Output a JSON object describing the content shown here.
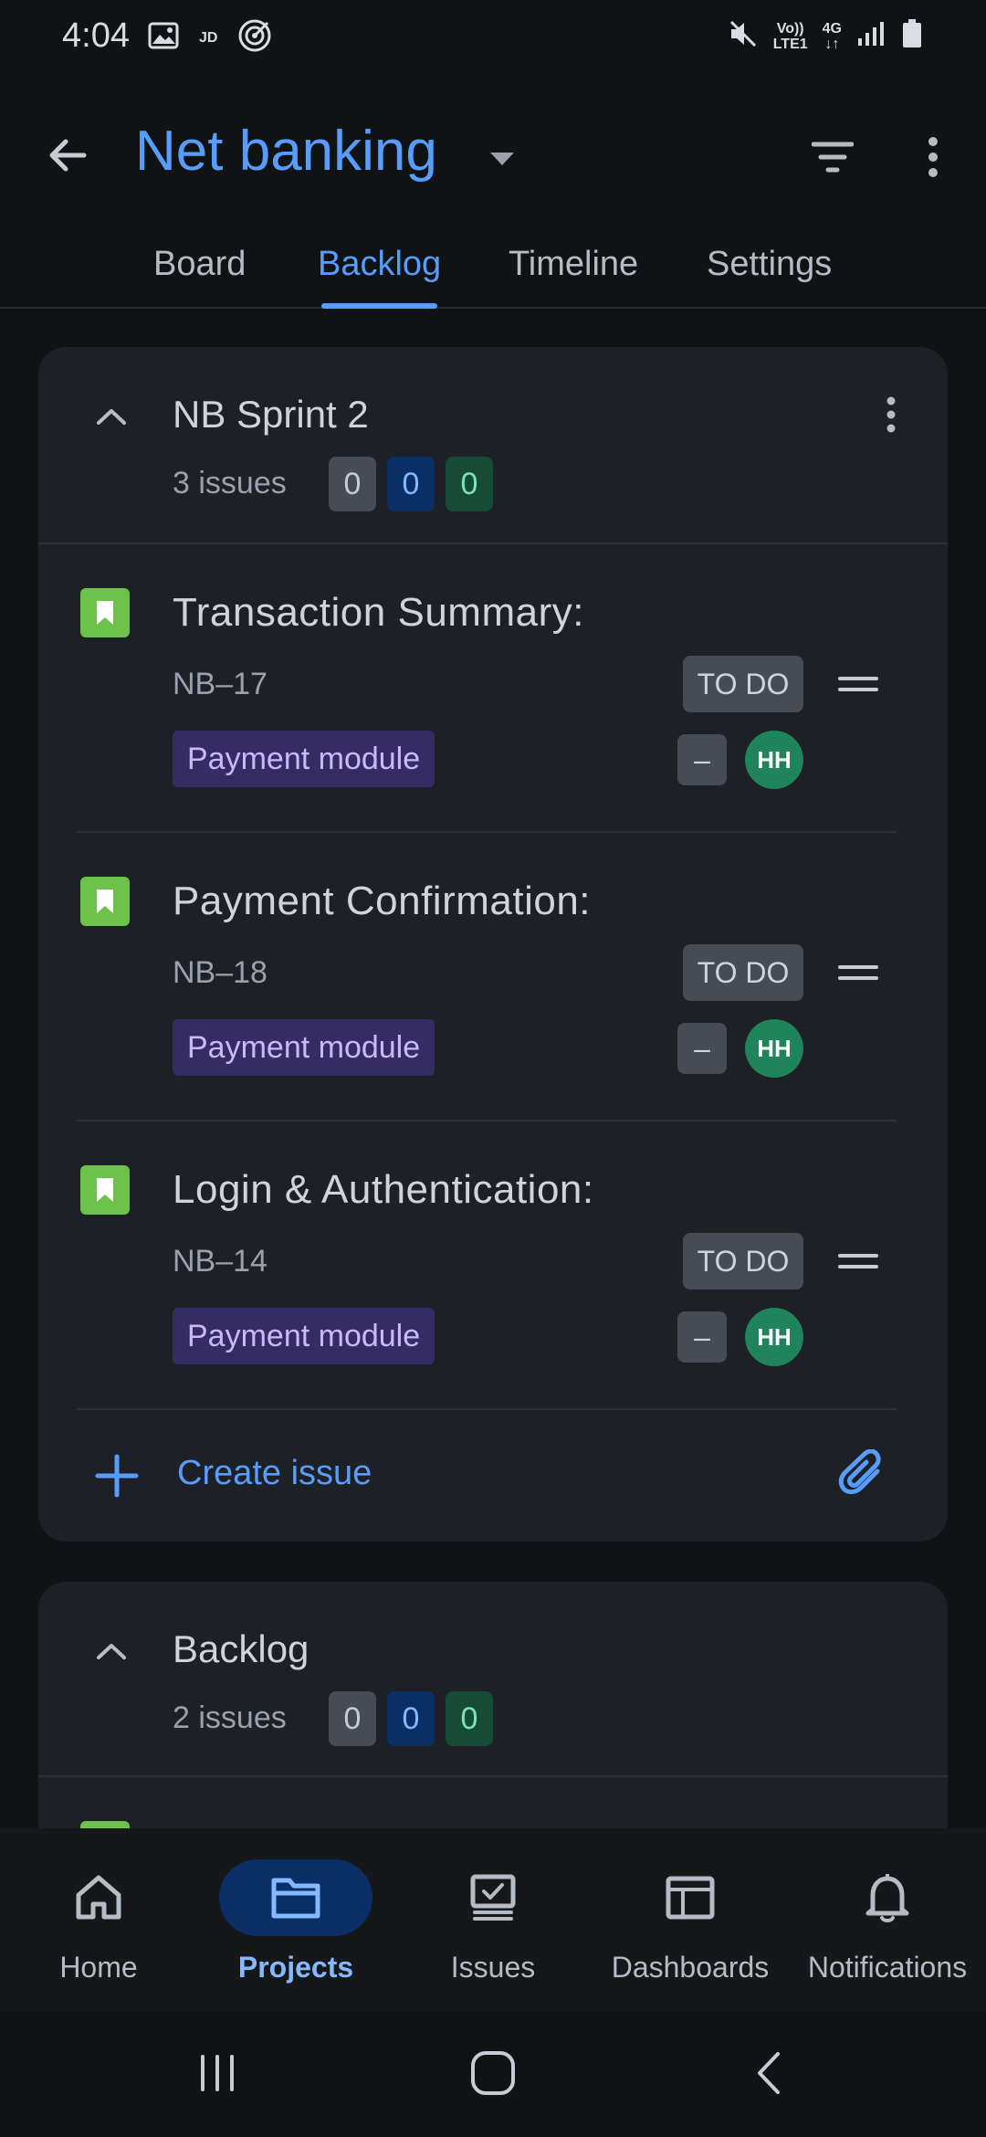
{
  "status_bar": {
    "time": "4:04",
    "carrier_label": "JD",
    "volte_line1": "Vo))",
    "volte_line2": "LTE1",
    "network_label": "4G"
  },
  "header": {
    "title": "Net banking"
  },
  "tabs": [
    {
      "label": "Board",
      "active": false
    },
    {
      "label": "Backlog",
      "active": true
    },
    {
      "label": "Timeline",
      "active": false
    },
    {
      "label": "Settings",
      "active": false
    }
  ],
  "sprint": {
    "title": "NB Sprint 2",
    "issue_count": "3 issues",
    "counts": {
      "todo": "0",
      "in_progress": "0",
      "done": "0"
    },
    "issues": [
      {
        "title": "Transaction Summary:",
        "key": "NB–17",
        "status": "TO DO",
        "label": "Payment module",
        "priority": "–",
        "assignee": "HH"
      },
      {
        "title": "Payment Confirmation:",
        "key": "NB–18",
        "status": "TO DO",
        "label": "Payment module",
        "priority": "–",
        "assignee": "HH"
      },
      {
        "title": "Login & Authentication:",
        "key": "NB–14",
        "status": "TO DO",
        "label": "Payment module",
        "priority": "–",
        "assignee": "HH"
      }
    ],
    "create_label": "Create issue"
  },
  "backlog": {
    "title": "Backlog",
    "issue_count": "2 issues",
    "counts": {
      "todo": "0",
      "in_progress": "0",
      "done": "0"
    }
  },
  "bottom_nav": [
    {
      "label": "Home",
      "icon": "home-icon",
      "active": false
    },
    {
      "label": "Projects",
      "icon": "folder-icon",
      "active": true
    },
    {
      "label": "Issues",
      "icon": "issues-icon",
      "active": false
    },
    {
      "label": "Dashboards",
      "icon": "dashboard-icon",
      "active": false
    },
    {
      "label": "Notifications",
      "icon": "bell-icon",
      "active": false
    }
  ],
  "colors": {
    "accent": "#579dff",
    "background": "#111214",
    "card": "#1d2025",
    "story_icon": "#6cc24a",
    "label_chip": "#352c63",
    "avatar": "#1f845a"
  }
}
